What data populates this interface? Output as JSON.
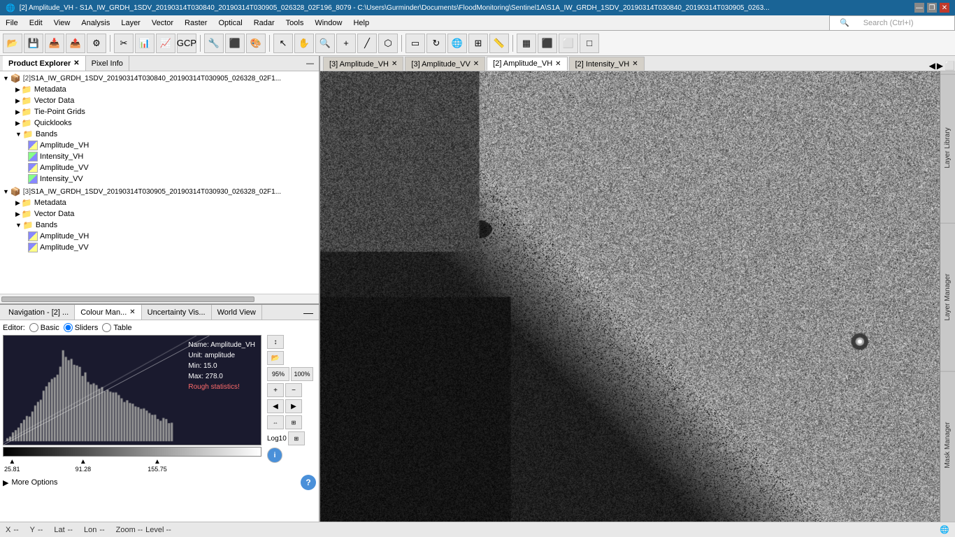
{
  "titleBar": {
    "title": "[2] Amplitude_VH - S1A_IW_GRDH_1SDV_20190314T030840_20190314T030905_026328_02F196_8079 - C:\\Users\\Gurminder\\Documents\\FloodMonitoring\\Sentinel1A\\S1A_IW_GRDH_1SDV_20190314T030840_20190314T030905_0263...",
    "controls": [
      "—",
      "❐",
      "✕"
    ]
  },
  "menuBar": {
    "items": [
      "File",
      "Edit",
      "View",
      "Analysis",
      "Layer",
      "Vector",
      "Raster",
      "Optical",
      "Radar",
      "Tools",
      "Window",
      "Help"
    ]
  },
  "toolbar": {
    "searchPlaceholder": "Search (Ctrl+I)"
  },
  "productExplorer": {
    "tabs": [
      {
        "label": "Product Explorer",
        "closeable": true,
        "active": true
      },
      {
        "label": "Pixel Info",
        "closeable": false,
        "active": false
      }
    ],
    "tree": [
      {
        "id": "product1",
        "label": "S1A_IW_GRDH_1SDV_20190314T030840_20190314T030905_026328_02F1...",
        "prefix": "[2]",
        "expanded": true,
        "indent": 0,
        "children": [
          {
            "label": "Metadata",
            "type": "folder",
            "indent": 1,
            "expanded": false
          },
          {
            "label": "Vector Data",
            "type": "folder",
            "indent": 1,
            "expanded": false
          },
          {
            "label": "Tie-Point Grids",
            "type": "folder",
            "indent": 1,
            "expanded": false
          },
          {
            "label": "Quicklooks",
            "type": "folder",
            "indent": 1,
            "expanded": false
          },
          {
            "label": "Bands",
            "type": "folder",
            "indent": 1,
            "expanded": true,
            "children": [
              {
                "label": "Amplitude_VH",
                "type": "band-a",
                "indent": 2
              },
              {
                "label": "Intensity_VH",
                "type": "band-v",
                "indent": 2
              },
              {
                "label": "Amplitude_VV",
                "type": "band-a",
                "indent": 2
              },
              {
                "label": "Intensity_VV",
                "type": "band-v",
                "indent": 2
              }
            ]
          }
        ]
      },
      {
        "id": "product2",
        "label": "S1A_IW_GRDH_1SDV_20190314T030905_20190314T030930_026328_02F1...",
        "prefix": "[3]",
        "expanded": true,
        "indent": 0,
        "children": [
          {
            "label": "Metadata",
            "type": "folder",
            "indent": 1,
            "expanded": false
          },
          {
            "label": "Vector Data",
            "type": "folder",
            "indent": 1,
            "expanded": false
          },
          {
            "label": "Bands",
            "type": "folder",
            "indent": 1,
            "expanded": true,
            "children": [
              {
                "label": "Amplitude_VH",
                "type": "band-a",
                "indent": 2
              },
              {
                "label": "Amplitude_VV",
                "type": "band-a",
                "indent": 2
              }
            ]
          }
        ]
      }
    ]
  },
  "bottomPanel": {
    "tabs": [
      {
        "label": "Navigation - [2] ...",
        "closeable": false,
        "active": false
      },
      {
        "label": "Colour Man...",
        "closeable": true,
        "active": true
      },
      {
        "label": "Uncertainty Vis...",
        "closeable": false,
        "active": false
      },
      {
        "label": "World View",
        "closeable": false,
        "active": false
      }
    ],
    "colourManager": {
      "editorLabel": "Editor:",
      "radioOptions": [
        "Basic",
        "Sliders",
        "Table"
      ],
      "activeRadio": "Sliders",
      "histogramInfo": {
        "name": "Name: Amplitude_VH",
        "unit": "Unit: amplitude",
        "min": "Min: 15.0",
        "max": "Max: 278.0",
        "note": "Rough statistics!"
      },
      "sliderValues": [
        "25.81",
        "91.28",
        "155.75"
      ],
      "percentButtons": [
        "95%",
        "100%"
      ],
      "logLabel": "Log10",
      "moreOptionsLabel": "More Options"
    }
  },
  "imageTabs": {
    "tabs": [
      {
        "label": "[3] Amplitude_VH",
        "active": false
      },
      {
        "label": "[3] Amplitude_VV",
        "active": false
      },
      {
        "label": "[2] Amplitude_VH",
        "active": true
      },
      {
        "label": "[2] Intensity_VH",
        "active": false
      }
    ]
  },
  "rightSidebar": {
    "panels": [
      "Layer Library",
      "Layer Manager",
      "Mask Manager"
    ]
  },
  "statusBar": {
    "x": "X",
    "xVal": "--",
    "y": "Y",
    "yVal": "--",
    "lat": "Lat",
    "latVal": "--",
    "lon": "Lon",
    "lonVal": "--",
    "zoom": "Zoom --",
    "level": "Level --"
  }
}
